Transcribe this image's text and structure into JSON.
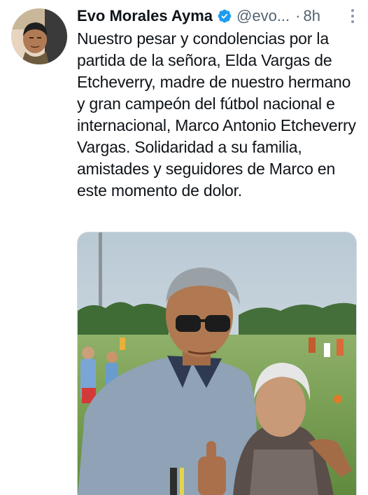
{
  "tweet": {
    "author": {
      "display_name": "Evo Morales Ayma",
      "handle": "@evo...",
      "verified_icon": "verified-badge-icon",
      "avatar": "profile-photo"
    },
    "separator": "·",
    "time": "8h",
    "more_icon": "more-options-icon",
    "text": "Nuestro pesar y condolencias por la partida de la señora, Elda Vargas de Etcheverry, madre de nuestro hermano y gran campeón del fútbol nacional e internacional, Marco Antonio Etcheverry Vargas. Solidaridad a su familia, amistades y seguidores de Marco en este momento de dolor.",
    "media": {
      "type": "photo"
    }
  },
  "colors": {
    "text_primary": "#0f1419",
    "text_secondary": "#536471",
    "verified_blue": "#1d9bf0",
    "background": "#ffffff"
  }
}
